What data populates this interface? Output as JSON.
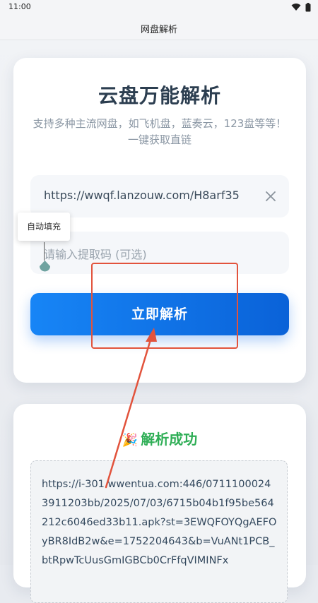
{
  "status_bar": {
    "time": "11:00"
  },
  "app_bar": {
    "title": "网盘解析"
  },
  "main_card": {
    "title": "云盘万能解析",
    "subtitle": "支持多种主流网盘，如飞机盘，蓝奏云，123盘等等！一键获取直链",
    "url_input_value": "https://wwqf.lanzouw.com/H8arf35",
    "code_input_placeholder": "请输入提取码 (可选)",
    "submit_label": "立即解析"
  },
  "autofill": {
    "label": "自动填充"
  },
  "result": {
    "emoji": "🎉",
    "title": "解析成功",
    "link": "https://i-301.wwentua.com:446/07111000243911203bb/2025/07/03/6715b04b1f95be564212c6046ed33b11.apk?st=3EWQFOYQgAEFOyBR8IdB2w&e=1752204643&b=VuANt1PCB_btRpwTcUusGmIGBCb0CrFfqVIMINFx"
  },
  "colors": {
    "primary": "#1785f6",
    "success": "#2fae56",
    "annotation": "#e2533c"
  },
  "icons": [
    "wifi-icon",
    "battery-icon",
    "clear-icon",
    "drop-handle-icon",
    "party-popper-icon"
  ]
}
